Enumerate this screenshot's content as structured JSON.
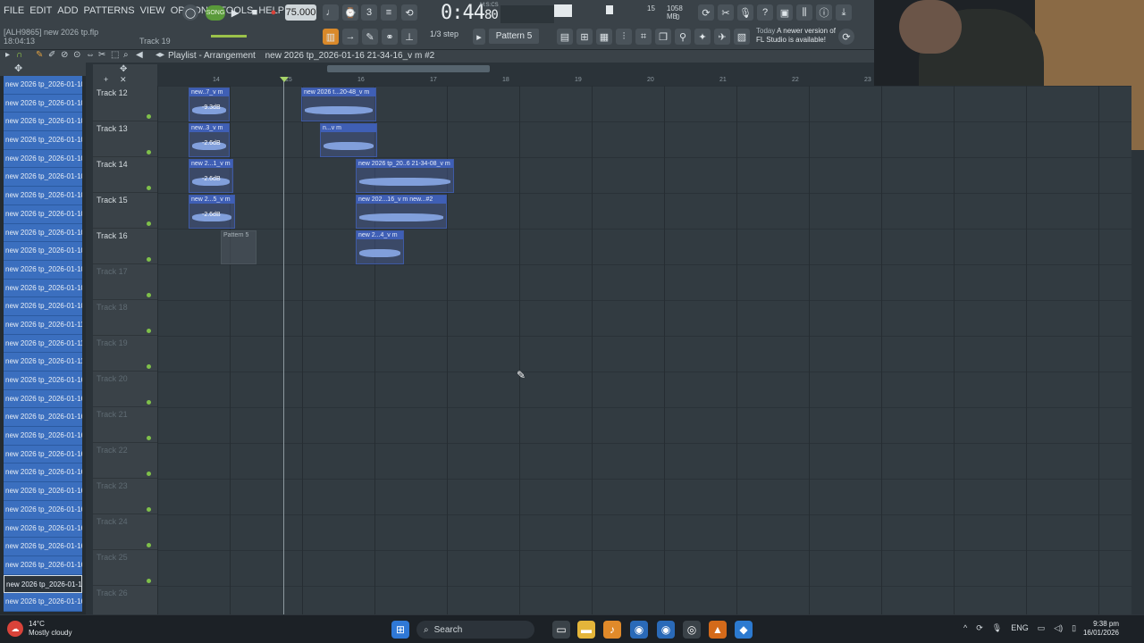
{
  "menu": [
    "FILE",
    "EDIT",
    "ADD",
    "PATTERNS",
    "VIEW",
    "OPTIONS",
    "TOOLS",
    "HELP"
  ],
  "file_info": {
    "line1": "[ALH9865] new 2026 tp.flp",
    "line2": "18:04:13"
  },
  "hint": "Track 19",
  "transport": {
    "song_label": "SONG",
    "tempo": "75.000",
    "time": "0:44",
    "time_sub": "80",
    "time_unit": "M:S:CS"
  },
  "cpu": {
    "value": "15",
    "mem": "1058 MB",
    "voices": "0"
  },
  "snap": "1/3 step",
  "pattern": "Pattern 5",
  "update_notice": {
    "when": "Today",
    "text": "A newer version of FL Studio is available!"
  },
  "playlist": {
    "title": "Playlist - Arrangement",
    "pattern_label": "new 2026 tp_2026-01-16 21-34-16_v m #2"
  },
  "ruler": [
    "14",
    "15",
    "16",
    "17",
    "18",
    "19",
    "20",
    "21",
    "22",
    "23"
  ],
  "browser_items": [
    "new 2026 tp_2026-01-10...",
    "new 2026 tp_2026-01-10...",
    "new 2026 tp_2026-01-10...",
    "new 2026 tp_2026-01-10...",
    "new 2026 tp_2026-01-10...",
    "new 2026 tp_2026-01-10...",
    "new 2026 tp_2026-01-10...",
    "new 2026 tp_2026-01-10...",
    "new 2026 tp_2026-01-10...",
    "new 2026 tp_2026-01-10...",
    "new 2026 tp_2026-01-10...",
    "new 2026 tp_2026-01-10...",
    "new 2026 tp_2026-01-10...",
    "new 2026 tp_2026-01-11...",
    "new 2026 tp_2026-01-11...",
    "new 2026 tp_2026-01-11...",
    "new 2026 tp_2026-01-16...",
    "new 2026 tp_2026-01-16...",
    "new 2026 tp_2026-01-16...",
    "new 2026 tp_2026-01-16...",
    "new 2026 tp_2026-01-16...",
    "new 2026 tp_2026-01-16...",
    "new 2026 tp_2026-01-16...",
    "new 2026 tp_2026-01-16...",
    "new 2026 tp_2026-01-16...",
    "new 2026 tp_2026-01-16...",
    "new 2026 tp_2026-01-16...",
    "new 2026 tp_2026-01-16...",
    "new 2026 tp_2026-01-16..."
  ],
  "tracks": [
    "Track 12",
    "Track 13",
    "Track 14",
    "Track 15",
    "Track 16",
    "Track 17",
    "Track 18",
    "Track 19",
    "Track 20",
    "Track 21",
    "Track 22",
    "Track 23",
    "Track 24",
    "Track 25",
    "Track 26"
  ],
  "clips": [
    {
      "label": "new..7_v m",
      "db": "-9.3dB"
    },
    {
      "label": "new 2026 t...20-48_v m",
      "db": ""
    },
    {
      "label": "new..3_v m",
      "db": "-2.6dB"
    },
    {
      "label": "n...v m",
      "db": ""
    },
    {
      "label": "new 2...1_v m",
      "db": "-2.6dB"
    },
    {
      "label": "new 2026 tp_20..6 21-34-08_v m",
      "db": ""
    },
    {
      "label": "new 2...5_v m",
      "db": "-2.6dB"
    },
    {
      "label": "new 202...16_v m  new...#2",
      "db": ""
    },
    {
      "label": "Pattern 5",
      "db": ""
    },
    {
      "label": "new 2...4_v m",
      "db": ""
    }
  ],
  "taskbar": {
    "weather_temp": "14°C",
    "weather_desc": "Mostly cloudy",
    "search": "Search",
    "lang": "ENG",
    "time": "9:38 pm",
    "date": "16/01/2026"
  },
  "colors": {
    "accent": "#3b6fbf",
    "clip": "#3f5fb5",
    "record": "#d9433a"
  }
}
